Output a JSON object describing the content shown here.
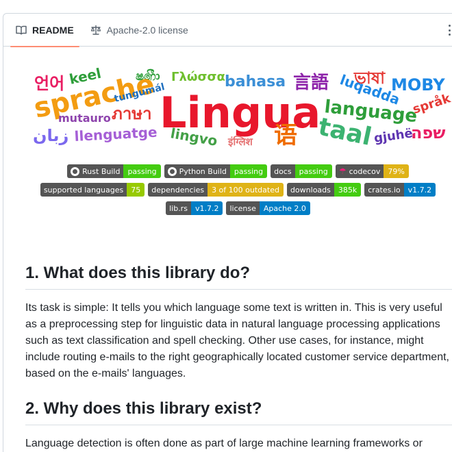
{
  "tabs": [
    {
      "label": "README",
      "icon": "book-icon",
      "active": true
    },
    {
      "label": "Apache-2.0 license",
      "icon": "scale-icon",
      "active": false
    }
  ],
  "logo": {
    "main": "Lingua",
    "words": [
      "언어",
      "keel",
      "ෂ෯ා",
      "Γλώσσα",
      "bahasa",
      "言語",
      "ভাষা",
      "MOBY",
      "sprache",
      "tungumál",
      "mutauro",
      "ภาษา",
      "luqadda",
      "language",
      "språk",
      "زبان",
      "llenguatge",
      "lingvo",
      "इंग्लिश",
      "语",
      "taal",
      "gjuhë",
      "שפה"
    ]
  },
  "badges": [
    [
      {
        "left": "Rust Build",
        "right": "passing",
        "color": "#4c1",
        "icon": "github-icon"
      },
      {
        "left": "Python Build",
        "right": "passing",
        "color": "#4c1",
        "icon": "github-icon"
      },
      {
        "left": "docs",
        "right": "passing",
        "color": "#4c1"
      },
      {
        "left": "codecov",
        "right": "79%",
        "color": "#dfb317",
        "icon": "umbrella-icon"
      }
    ],
    [
      {
        "left": "supported languages",
        "right": "75",
        "color": "#97ca00"
      },
      {
        "left": "dependencies",
        "right": "3 of 100 outdated",
        "color": "#dfb317"
      },
      {
        "left": "downloads",
        "right": "385k",
        "color": "#4c1"
      },
      {
        "left": "crates.io",
        "right": "v1.7.2",
        "color": "#007ec6"
      }
    ],
    [
      {
        "left": "lib.rs",
        "right": "v1.7.2",
        "color": "#007ec6"
      },
      {
        "left": "license",
        "right": "Apache 2.0",
        "color": "#007ec6"
      }
    ]
  ],
  "sections": [
    {
      "heading": "1. What does this library do?",
      "text": "Its task is simple: It tells you which language some text is written in. This is very useful as a preprocessing step for linguistic data in natural language processing applications such as text classification and spell checking. Other use cases, for instance, might include routing e-mails to the right geographically located customer service department, based on the e-mails' languages."
    },
    {
      "heading": "2. Why does this library exist?",
      "text": "Language detection is often done as part of large machine learning frameworks or"
    }
  ]
}
